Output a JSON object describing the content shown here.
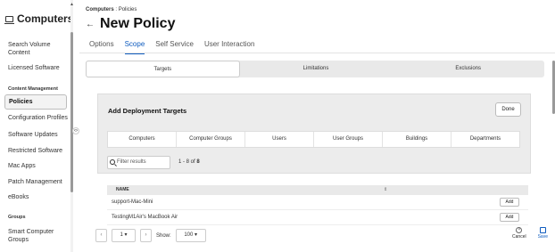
{
  "sidebar": {
    "title": "Computers",
    "items": {
      "search_volume": "Search Volume Content",
      "licensed": "Licensed Software",
      "section_content": "Content Management",
      "policies": "Policies",
      "config_profiles": "Configuration Profiles",
      "software_updates": "Software Updates",
      "restricted": "Restricted Software",
      "mac_apps": "Mac Apps",
      "patch": "Patch Management",
      "ebooks": "eBooks",
      "section_groups": "Groups",
      "smart_groups": "Smart Computer Groups"
    }
  },
  "header": {
    "breadcrumb_root": "Computers",
    "breadcrumb_sep": " : ",
    "breadcrumb_leaf": "Policies",
    "back": "←",
    "title": "New Policy"
  },
  "tabs": [
    "Options",
    "Scope",
    "Self Service",
    "User Interaction"
  ],
  "scope_segments": [
    "Targets",
    "Limitations",
    "Exclusions"
  ],
  "panel": {
    "title": "Add Deployment Targets",
    "done": "Done",
    "subtabs": [
      "Computers",
      "Computer Groups",
      "Users",
      "User Groups",
      "Buildings",
      "Departments"
    ],
    "filter_placeholder": "Filter results",
    "count_prefix": "1 - 8 of ",
    "count_total": "8"
  },
  "table": {
    "column_name": "NAME",
    "sort_glyph": "⇕",
    "rows": [
      {
        "name": "support-Mac-Mini",
        "action": "Add"
      },
      {
        "name": "TestingM1Air's MacBook Air",
        "action": "Add"
      }
    ]
  },
  "pager": {
    "prev": "‹",
    "page": "1",
    "page_caret": "▾",
    "next": "›",
    "show_label": "Show:",
    "page_size": "100",
    "size_caret": "▾"
  },
  "footer": {
    "cancel": "Cancel",
    "save": "Save"
  }
}
